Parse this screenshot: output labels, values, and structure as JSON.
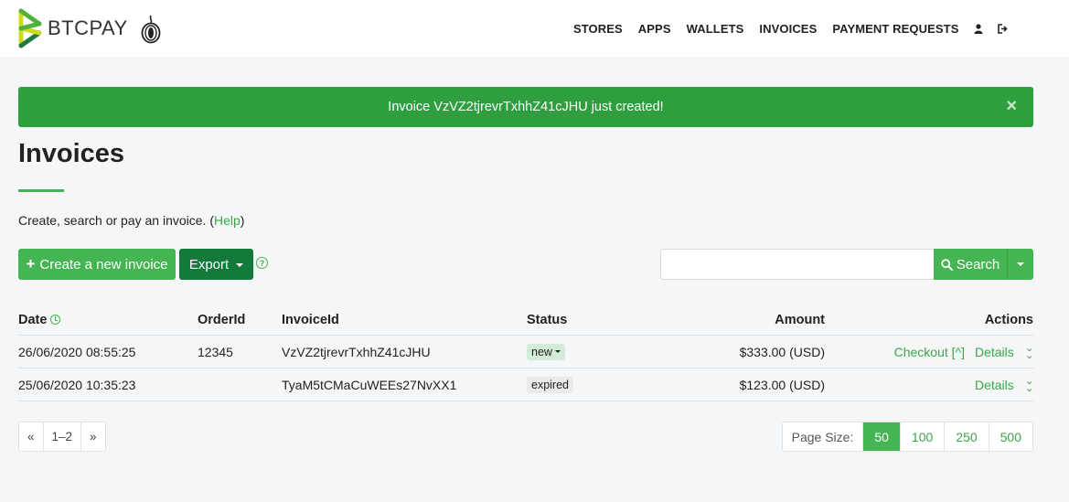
{
  "nav": {
    "brand": "BTCPAY",
    "links": [
      "STORES",
      "APPS",
      "WALLETS",
      "INVOICES",
      "PAYMENT REQUESTS"
    ]
  },
  "alert": {
    "message": "Invoice VzVZ2tjrevrTxhhZ41cJHU just created!",
    "close": "×"
  },
  "page": {
    "title": "Invoices",
    "intro_text": "Create, search or pay an invoice. (",
    "help_link": "Help",
    "intro_end": ")"
  },
  "toolbar": {
    "create_label": "Create a new invoice",
    "create_icon": "+",
    "export_label": "Export",
    "search_placeholder": "",
    "search_value": "",
    "search_label": "Search"
  },
  "table": {
    "headers": {
      "date": "Date",
      "order_id": "OrderId",
      "invoice_id": "InvoiceId",
      "status": "Status",
      "amount": "Amount",
      "actions": "Actions"
    },
    "rows": [
      {
        "date": "26/06/2020 08:55:25",
        "order_id": "12345",
        "invoice_id": "VzVZ2tjrevrTxhhZ41cJHU",
        "status": "new",
        "amount": "$333.00 (USD)",
        "checkout": "Checkout [^]",
        "details": "Details"
      },
      {
        "date": "25/06/2020 10:35:23",
        "order_id": "",
        "invoice_id": "TyaM5tCMaCuWEEs27NvXX1",
        "status": "expired",
        "amount": "$123.00 (USD)",
        "checkout": "",
        "details": "Details"
      }
    ]
  },
  "pager": {
    "prev": "«",
    "range": "1–2",
    "next": "»"
  },
  "page_size": {
    "label": "Page Size:",
    "options": [
      "50",
      "100",
      "250",
      "500"
    ],
    "selected": "50"
  },
  "colors": {
    "brand_green": "#44b552",
    "alert_green": "#2e9e3f",
    "export_green": "#147a3c"
  }
}
